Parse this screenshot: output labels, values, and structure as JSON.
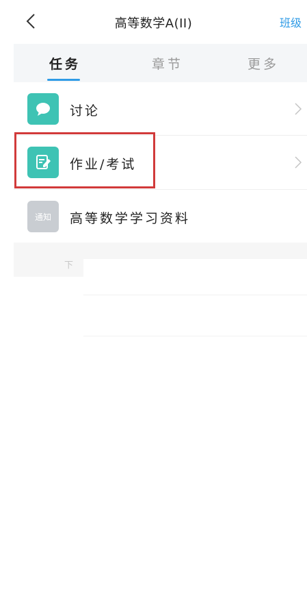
{
  "header": {
    "title": "高等数学A(II)",
    "right_action": "班级"
  },
  "tabs": [
    {
      "label": "任务",
      "active": true
    },
    {
      "label": "章节",
      "active": false
    },
    {
      "label": "更多",
      "active": false
    }
  ],
  "list": [
    {
      "label": "讨论",
      "icon": "chat-bubble-icon",
      "icon_color": "#3ec3b4"
    },
    {
      "label": "作业/考试",
      "icon": "edit-note-icon",
      "icon_color": "#3ec3b4"
    },
    {
      "label": "高等数学学习资料",
      "icon_text": "通知",
      "icon_color": "#c9cdd2"
    }
  ],
  "lower": {
    "partial_text": "下"
  },
  "colors": {
    "accent": "#2f9be6",
    "teal": "#3ec3b4",
    "highlight": "#d13a3a"
  }
}
